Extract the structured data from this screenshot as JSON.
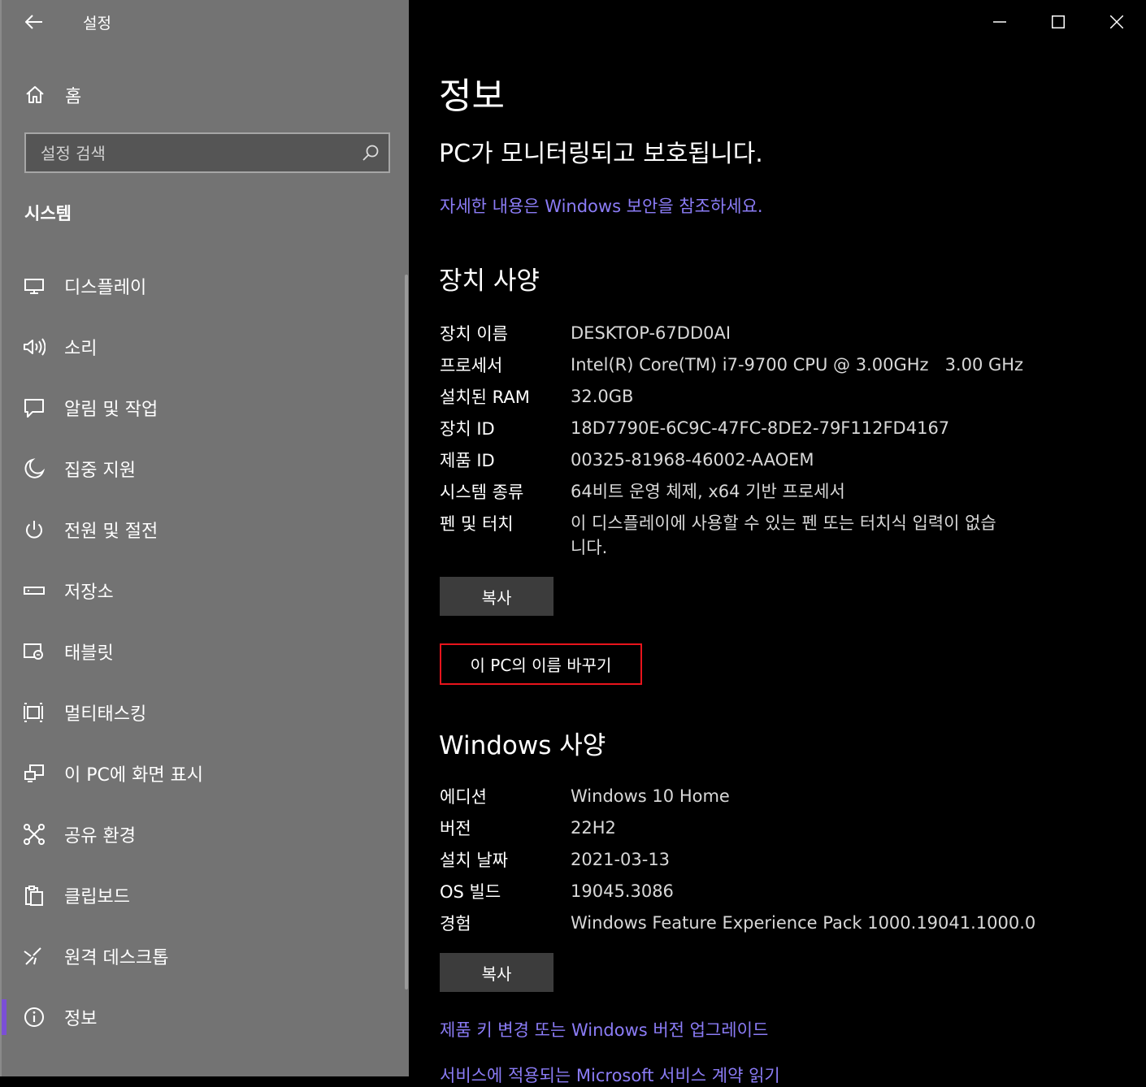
{
  "app": {
    "title": "설정"
  },
  "sidebar": {
    "home_label": "홈",
    "search_placeholder": "설정 검색",
    "section_title": "시스템",
    "items": [
      {
        "label": "디스플레이",
        "icon": "display-icon"
      },
      {
        "label": "소리",
        "icon": "speaker-icon"
      },
      {
        "label": "알림 및 작업",
        "icon": "notification-icon"
      },
      {
        "label": "집중 지원",
        "icon": "moon-icon"
      },
      {
        "label": "전원 및 절전",
        "icon": "power-icon"
      },
      {
        "label": "저장소",
        "icon": "storage-icon"
      },
      {
        "label": "태블릿",
        "icon": "tablet-icon"
      },
      {
        "label": "멀티태스킹",
        "icon": "multitasking-icon"
      },
      {
        "label": "이 PC에 화면 표시",
        "icon": "project-icon"
      },
      {
        "label": "공유 환경",
        "icon": "shared-experiences-icon"
      },
      {
        "label": "클립보드",
        "icon": "clipboard-icon"
      },
      {
        "label": "원격 데스크톱",
        "icon": "remote-desktop-icon"
      },
      {
        "label": "정보",
        "icon": "info-icon",
        "active": true
      }
    ]
  },
  "main": {
    "title": "정보",
    "status": "PC가 모니터링되고 보호됩니다.",
    "security_link": "자세한 내용은 Windows 보안을 참조하세요.",
    "device_specs": {
      "heading": "장치 사양",
      "rows": [
        {
          "key": "장치 이름",
          "value": "DESKTOP-67DD0AI"
        },
        {
          "key": "프로세서",
          "value": "Intel(R) Core(TM) i7-9700 CPU @ 3.00GHz   3.00 GHz"
        },
        {
          "key": "설치된 RAM",
          "value": "32.0GB"
        },
        {
          "key": "장치 ID",
          "value": "18D7790E-6C9C-47FC-8DE2-79F112FD4167"
        },
        {
          "key": "제품 ID",
          "value": "00325-81968-46002-AAOEM"
        },
        {
          "key": "시스템 종류",
          "value": "64비트 운영 체제, x64 기반 프로세서"
        },
        {
          "key": "펜 및 터치",
          "value": "이 디스플레이에 사용할 수 있는 펜 또는 터치식 입력이 없습니다."
        }
      ],
      "copy_label": "복사",
      "rename_label": "이 PC의 이름 바꾸기"
    },
    "windows_specs": {
      "heading": "Windows 사양",
      "rows": [
        {
          "key": "에디션",
          "value": "Windows 10 Home"
        },
        {
          "key": "버전",
          "value": "22H2"
        },
        {
          "key": "설치 날짜",
          "value": "2021-03-13"
        },
        {
          "key": "OS 빌드",
          "value": "19045.3086"
        },
        {
          "key": "경험",
          "value": "Windows Feature Experience Pack 1000.19041.1000.0"
        }
      ],
      "copy_label": "복사"
    },
    "upgrade_link": "제품 키 변경 또는 Windows 버전 업그레이드",
    "services_link": "서비스에 적용되는 Microsoft 서비스 계약 읽기"
  },
  "colors": {
    "accent": "#7b4fd6",
    "link": "#8b7cf6",
    "highlight": "#e8141c",
    "sidebar_bg": "#737373"
  }
}
